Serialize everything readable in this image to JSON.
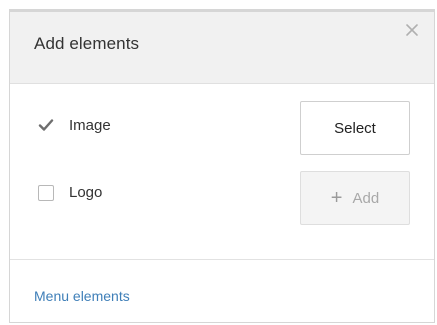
{
  "dialog": {
    "title": "Add elements",
    "close_icon": "close-icon"
  },
  "options": [
    {
      "label": "Image",
      "checked": true
    },
    {
      "label": "Logo",
      "checked": false
    }
  ],
  "buttons": {
    "select_label": "Select",
    "add_label": "Add",
    "add_icon": "plus-icon",
    "add_disabled": true
  },
  "footer": {
    "link_label": "Menu elements"
  },
  "colors": {
    "header_bg": "#f1f1f1",
    "link": "#3f7fb8",
    "border": "#d6d6d6"
  }
}
